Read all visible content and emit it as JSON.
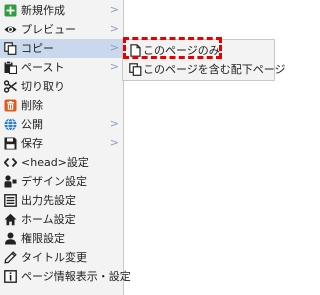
{
  "menu": {
    "items": [
      {
        "label": "新規作成",
        "icon": "plus-box-icon",
        "has_submenu": true
      },
      {
        "label": "プレビュー",
        "icon": "eye-icon",
        "has_submenu": true
      },
      {
        "label": "コピー",
        "icon": "copy-icon",
        "has_submenu": true,
        "active": true
      },
      {
        "label": "ペースト",
        "icon": "paste-icon",
        "has_submenu": true
      },
      {
        "label": "切り取り",
        "icon": "scissors-icon",
        "has_submenu": false
      },
      {
        "label": "削除",
        "icon": "trash-icon",
        "has_submenu": false
      },
      {
        "label": "公開",
        "icon": "globe-icon",
        "has_submenu": true
      },
      {
        "label": "保存",
        "icon": "save-icon",
        "has_submenu": true
      },
      {
        "label": "<head>設定",
        "icon": "code-icon",
        "has_submenu": false
      },
      {
        "label": "デザイン設定",
        "icon": "design-icon",
        "has_submenu": false
      },
      {
        "label": "出力先設定",
        "icon": "output-icon",
        "has_submenu": false
      },
      {
        "label": "ホーム設定",
        "icon": "home-icon",
        "has_submenu": false
      },
      {
        "label": "権限設定",
        "icon": "user-icon",
        "has_submenu": false
      },
      {
        "label": "タイトル変更",
        "icon": "pencil-icon",
        "has_submenu": false
      },
      {
        "label": "ページ情報表示・設定",
        "icon": "info-icon",
        "has_submenu": false
      }
    ],
    "arrow_glyph": ">"
  },
  "submenu": {
    "items": [
      {
        "label": "このページのみ",
        "icon": "page-icon"
      },
      {
        "label": "このページを含む配下ページ",
        "icon": "pages-icon"
      }
    ]
  },
  "colors": {
    "active_bg": "#c9d8ec",
    "highlight": "#e60000",
    "plus_green": "#2e9e3e",
    "delete_orange": "#e8561e",
    "globe_blue": "#2f7fd1"
  }
}
